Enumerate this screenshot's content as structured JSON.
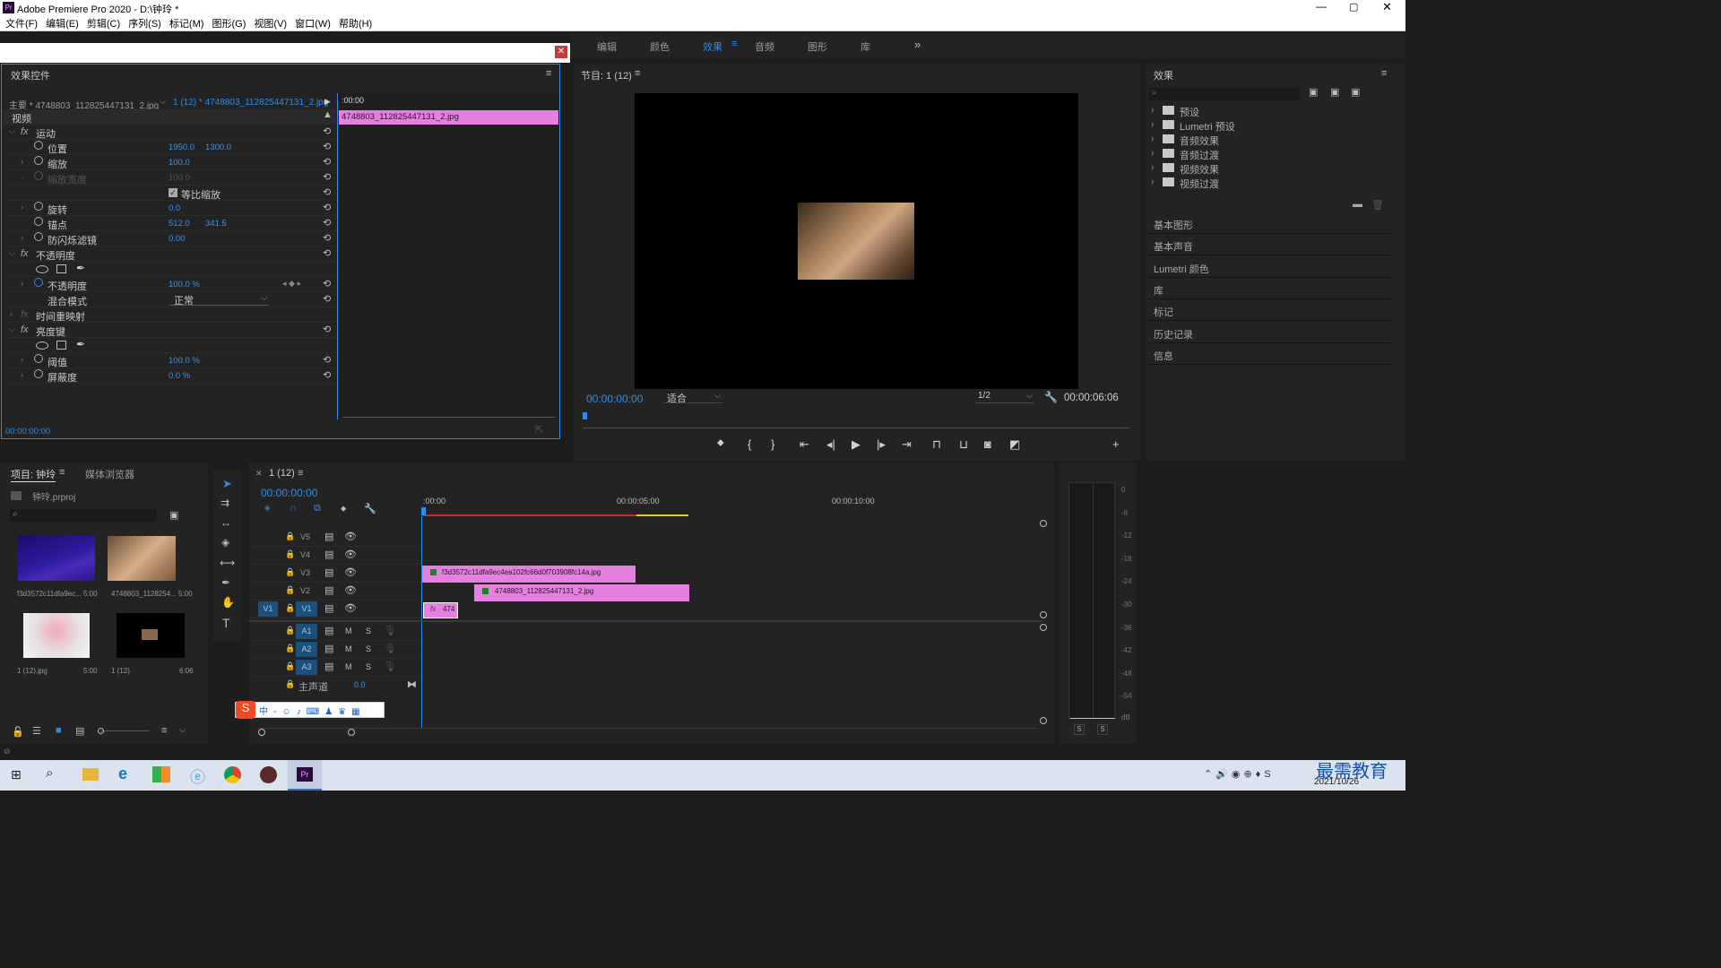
{
  "title": "Adobe Premiere Pro 2020 - D:\\钟玲 *",
  "menus": [
    "文件(F)",
    "编辑(E)",
    "剪辑(C)",
    "序列(S)",
    "标记(M)",
    "图形(G)",
    "视图(V)",
    "窗口(W)",
    "帮助(H)"
  ],
  "workspaces": [
    "编辑",
    "颜色",
    "效果",
    "音频",
    "图形",
    "库"
  ],
  "active_workspace": "效果",
  "effect_controls": {
    "title": "效果控件",
    "master_label": "主要 * 4748803_112825447131_2.jpg",
    "sequence_label": "1 (12) * 4748803_112825447131_2.jpg",
    "ruler_time": ":00:00",
    "clip_name": "4748803_112825447131_2.jpg",
    "video_header": "视频",
    "motion": "运动",
    "position": "位置",
    "position_x": "1950.0",
    "position_y": "1300.0",
    "scale": "缩放",
    "scale_val": "100.0",
    "scale_width": "缩放宽度",
    "scale_width_val": "100.0",
    "uniform": "等比缩放",
    "rotation": "旋转",
    "rotation_val": "0.0",
    "anchor": "锚点",
    "anchor_x": "512.0",
    "anchor_y": "341.5",
    "flicker": "防闪烁滤镜",
    "flicker_val": "0.00",
    "opacity_group": "不透明度",
    "opacity": "不透明度",
    "opacity_val": "100.0 %",
    "blend": "混合模式",
    "blend_val": "正常",
    "time_remap": "时间重映射",
    "luma_key": "亮度键",
    "threshold": "阈值",
    "threshold_val": "100.0 %",
    "cutoff": "屏蔽度",
    "cutoff_val": "0.0 %",
    "timecode": "00:00:00:00"
  },
  "program": {
    "title": "节目: 1 (12)",
    "timecode": "00:00:00:00",
    "fit": "适合",
    "resolution": "1/2",
    "duration": "00:00:06:06"
  },
  "effects": {
    "title": "效果",
    "search_placeholder": "",
    "folders": [
      "预设",
      "Lumetri 预设",
      "音频效果",
      "音频过渡",
      "视频效果",
      "视频过渡"
    ],
    "panels": [
      "基本图形",
      "基本声音",
      "Lumetri 颜色",
      "库",
      "标记",
      "历史记录",
      "信息"
    ]
  },
  "project": {
    "tab1": "项目: 钟玲",
    "tab2": "媒体浏览器",
    "file": "钟玲.prproj",
    "items": [
      {
        "name": "f3d3572c11dfa9ec...",
        "dur": "5:00"
      },
      {
        "name": "4748803_1128254...",
        "dur": "5:00"
      },
      {
        "name": "1 (12).jpg",
        "dur": "5:00"
      },
      {
        "name": "1 (12)",
        "dur": "6:06"
      }
    ]
  },
  "timeline": {
    "tab": "1 (12)",
    "timecode": "00:00:00:00",
    "ruler": [
      ":00:00",
      "00:00:05:00",
      "00:00:10:00"
    ],
    "tracks_v": [
      "V5",
      "V4",
      "V3",
      "V2",
      "V1"
    ],
    "tracks_a": [
      "A1",
      "A2",
      "A3"
    ],
    "master": "主声道",
    "master_val": "0.0",
    "clip_v3": "f3d3572c11dfa9ec4ea102fc66d0f703908fc14a.jpg",
    "clip_v2": "4748803_112825447131_2.jpg",
    "clip_v1": "474",
    "src_v1": "V1",
    "ms": [
      "M",
      "S"
    ]
  },
  "meter": {
    "scale": [
      "0",
      "-6",
      "-12",
      "-18",
      "-24",
      "-30",
      "-36",
      "-42",
      "-48",
      "-54",
      "dB"
    ],
    "solo": [
      "S",
      "S"
    ]
  },
  "taskbar": {
    "date": "2021/10/26",
    "watermark": "最需教育"
  },
  "colors": {
    "accent": "#2d8ceb",
    "clip": "#e481e0",
    "bg": "#232323"
  }
}
